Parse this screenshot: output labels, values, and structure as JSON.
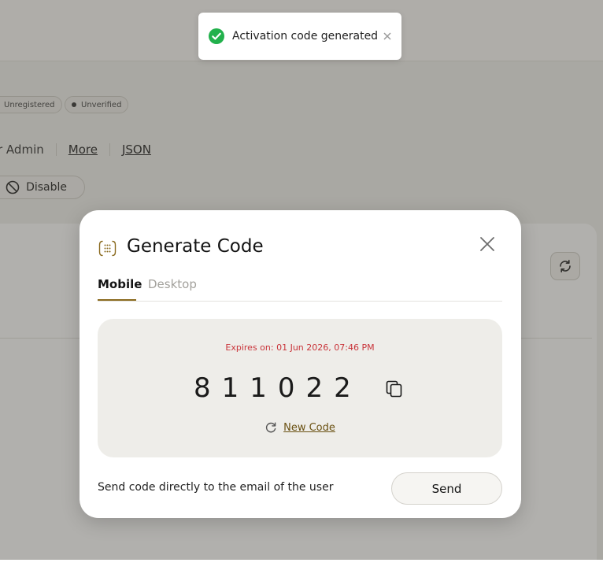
{
  "background": {
    "badges": [
      "Unregistered",
      "Unverified"
    ],
    "links": {
      "admin_text": "r Admin",
      "more": "More",
      "json": "JSON"
    },
    "disable_label": "Disable"
  },
  "toast": {
    "message": "Activation code generated",
    "icon": "check-circle-icon",
    "close_icon": "close-icon"
  },
  "modal": {
    "title": "Generate Code",
    "tabs": [
      {
        "label": "Mobile",
        "active": true
      },
      {
        "label": "Desktop",
        "active": false
      }
    ],
    "expires": "Expires on: 01 Jun 2026, 07:46 PM",
    "code": "811022",
    "new_code_label": "New Code",
    "send_text": "Send code directly to the email of the user",
    "send_label": "Send"
  },
  "colors": {
    "accent": "#8a6a1e",
    "expires_red": "#c9343a",
    "success_green": "#22b14c",
    "panel_bg": "#eeede9"
  }
}
